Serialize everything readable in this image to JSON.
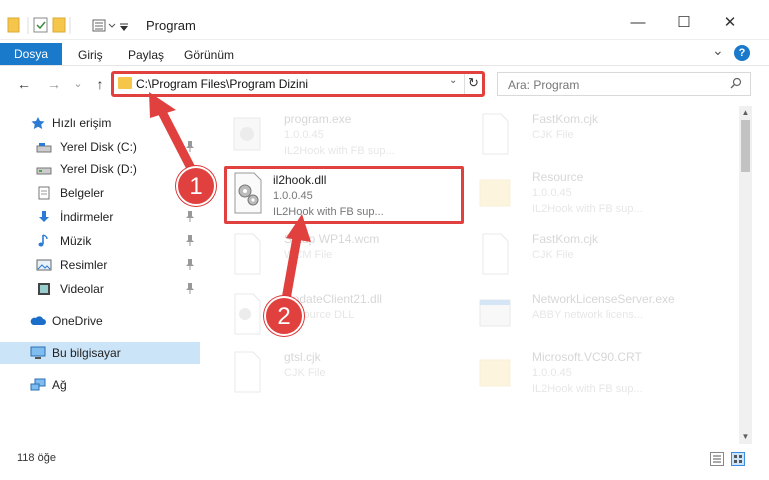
{
  "window": {
    "title": "Program",
    "minimize_glyph": "—",
    "maximize_glyph": "☐",
    "close_glyph": "✕"
  },
  "ribbon": {
    "tabs": [
      "Dosya",
      "Giriş",
      "Paylaş",
      "Görünüm"
    ],
    "expand_glyph": "⌄",
    "help_glyph": "?"
  },
  "nav": {
    "back_glyph": "←",
    "forward_glyph": "→",
    "recent_glyph": "⌄",
    "up_glyph": "↑",
    "address": "C:\\Program Files\\Program Dizini",
    "dropdown_glyph": "⌄",
    "refresh_glyph": "↻",
    "search_placeholder": "Ara: Program"
  },
  "sidebar": {
    "items": [
      {
        "label": "Hızlı erişim",
        "icon": "star-icon",
        "pinned": false
      },
      {
        "label": "Yerel Disk (C:)",
        "icon": "drive-icon",
        "pinned": true
      },
      {
        "label": "Yerel Disk (D:)",
        "icon": "drive-icon",
        "pinned": true
      },
      {
        "label": "Belgeler",
        "icon": "documents-icon",
        "pinned": true
      },
      {
        "label": "İndirmeler",
        "icon": "download-icon",
        "pinned": true
      },
      {
        "label": "Müzik",
        "icon": "music-icon",
        "pinned": true
      },
      {
        "label": "Resimler",
        "icon": "pictures-icon",
        "pinned": true
      },
      {
        "label": "Videolar",
        "icon": "video-icon",
        "pinned": true
      },
      {
        "label": "OneDrive",
        "icon": "cloud-icon",
        "pinned": false
      },
      {
        "label": "Bu bilgisayar",
        "icon": "computer-icon",
        "pinned": false
      },
      {
        "label": "Ağ",
        "icon": "network-icon",
        "pinned": false
      }
    ],
    "pin_glyph": "📌"
  },
  "files": [
    {
      "name": "program.exe",
      "line1": "1.0.0.45",
      "line2": "IL2Hook with FB sup...",
      "icon": "exe-icon"
    },
    {
      "name": "FastKom.cjk",
      "line1": "CJK File",
      "line2": "",
      "icon": "file-icon"
    },
    {
      "name": "il2hook.dll",
      "line1": "1.0.0.45",
      "line2": "IL2Hook with FB sup...",
      "icon": "dll-gear-icon"
    },
    {
      "name": "Resource",
      "line1": "1.0.0.45",
      "line2": "IL2Hook with FB sup...",
      "icon": "folder-icon"
    },
    {
      "name": "Setup WP14.wcm",
      "line1": "WCM File",
      "line2": "",
      "icon": "file-icon"
    },
    {
      "name": "FastKom.cjk",
      "line1": "CJK File",
      "line2": "",
      "icon": "file-icon"
    },
    {
      "name": "UpdateClient21.dll",
      "line1": "Resource DLL",
      "line2": "",
      "icon": "dll-gear-icon"
    },
    {
      "name": "NetworkLicenseServer.exe",
      "line1": "ABBY network licens...",
      "line2": "",
      "icon": "exe-window-icon"
    },
    {
      "name": "gtsl.cjk",
      "line1": "CJK File",
      "line2": "",
      "icon": "file-icon"
    },
    {
      "name": "Microsoft.VC90.CRT",
      "line1": "1.0.0.45",
      "line2": "IL2Hook with FB sup...",
      "icon": "folder-icon"
    }
  ],
  "status": {
    "count_text": "118 öğe"
  },
  "annotations": {
    "callout_1": "1",
    "callout_2": "2"
  },
  "colors": {
    "accent": "#1979ca",
    "highlight": "#e0413f",
    "folder": "#f6c64a"
  }
}
